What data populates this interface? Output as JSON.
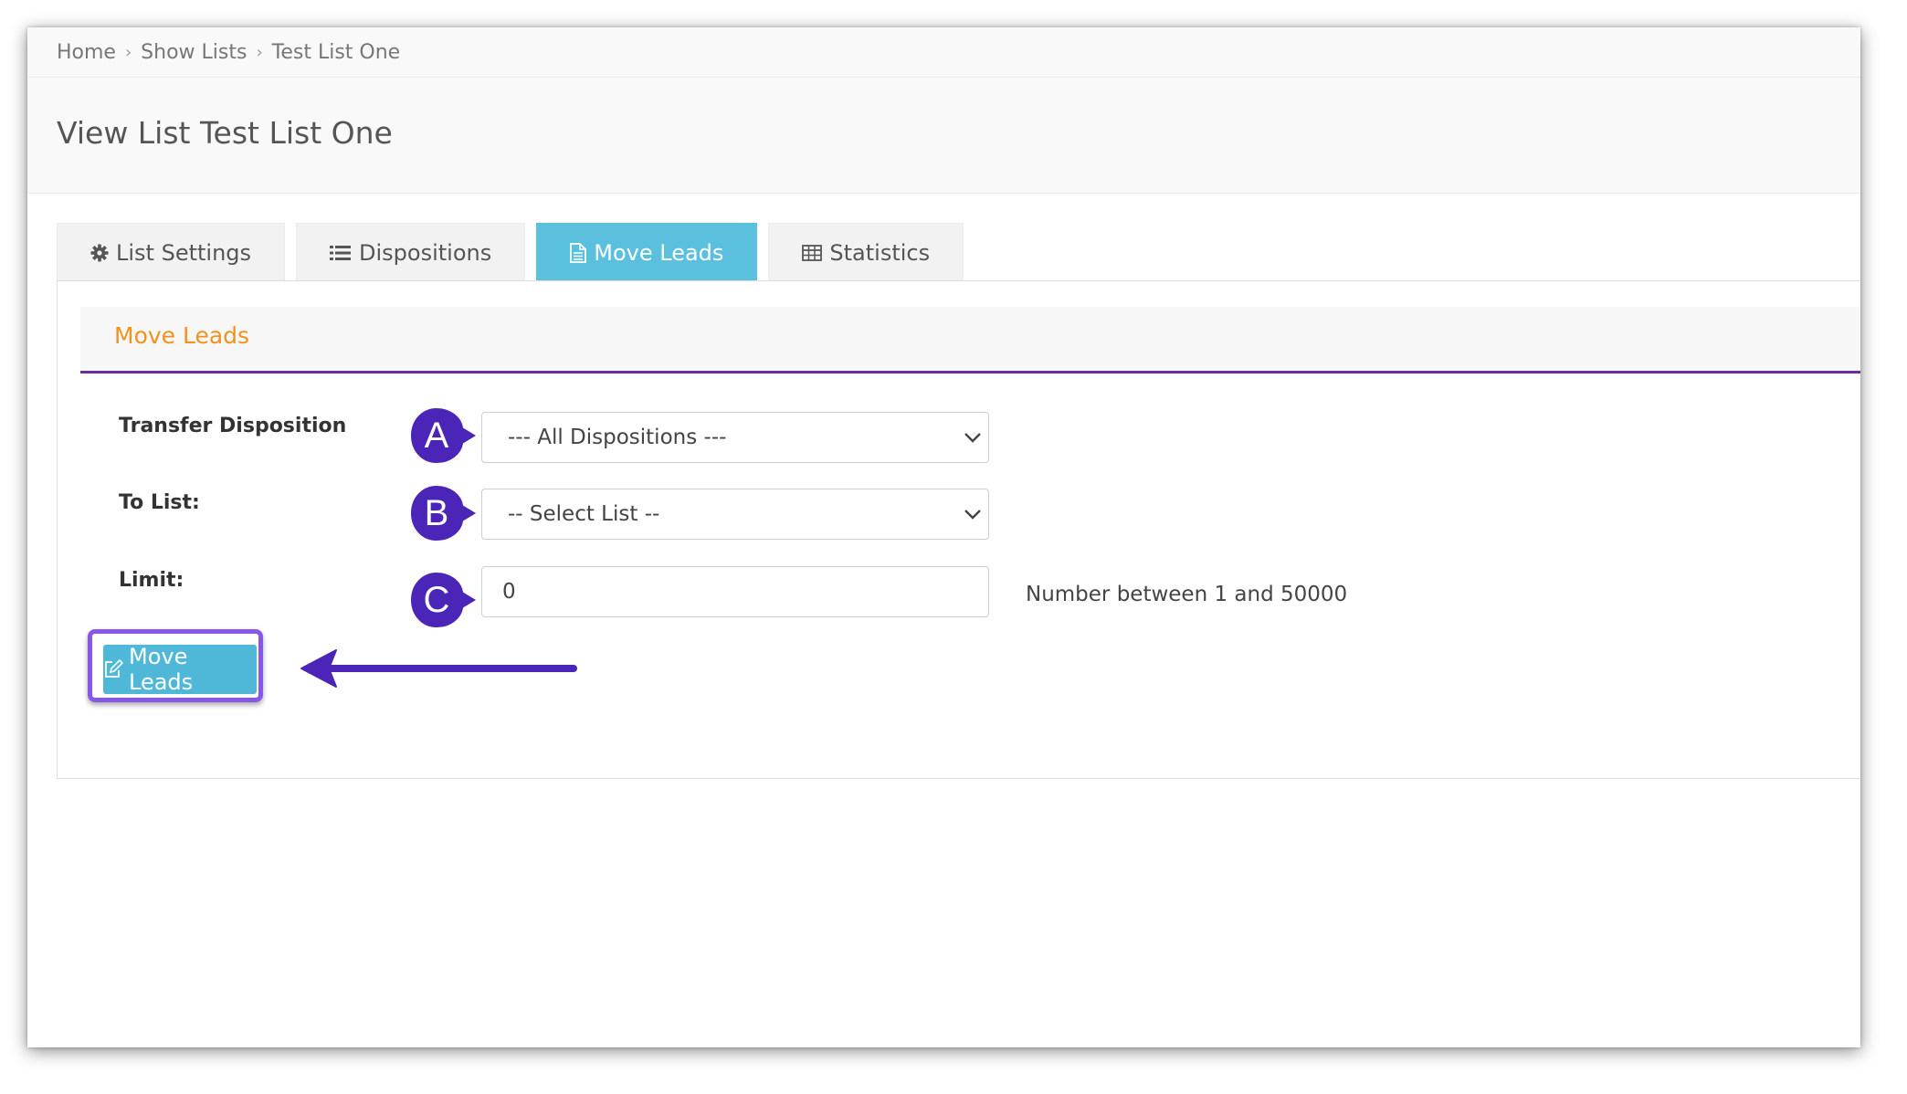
{
  "breadcrumb": {
    "items": [
      "Home",
      "Show Lists",
      "Test List One"
    ]
  },
  "page": {
    "title": "View List Test List One"
  },
  "tabs": [
    {
      "label": "List Settings",
      "icon": "gear-icon",
      "active": false
    },
    {
      "label": "Dispositions",
      "icon": "list-icon",
      "active": false
    },
    {
      "label": "Move Leads",
      "icon": "document-icon",
      "active": true
    },
    {
      "label": "Statistics",
      "icon": "table-icon",
      "active": false
    }
  ],
  "panel": {
    "title": "Move Leads"
  },
  "form": {
    "transfer_disposition": {
      "label": "Transfer Disposition",
      "selected": "--- All Dispositions ---"
    },
    "to_list": {
      "label": "To List:",
      "selected": "-- Select List --"
    },
    "limit": {
      "label": "Limit:",
      "value": "0",
      "help": "Number between 1 and 50000"
    },
    "submit_label": "Move Leads"
  },
  "annotations": {
    "badges": [
      "A",
      "B",
      "C"
    ],
    "color": "#4b24b8",
    "highlight_color": "#8757e8"
  },
  "colors": {
    "accent": "#5bc0de",
    "panel_title": "#f0921e",
    "panel_rule": "#6a2ca0"
  }
}
